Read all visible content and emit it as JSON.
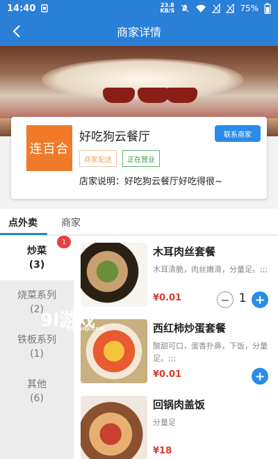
{
  "status_bar": {
    "time": "14:40",
    "speed_value": "23.8",
    "speed_unit": "KB/S",
    "battery": "75%"
  },
  "navbar": {
    "title": "商家详情",
    "back_icon": "back-arrow-icon"
  },
  "shop": {
    "logo_text": "连百合",
    "name": "好吃狗云餐厅",
    "tags": [
      "商家配送",
      "正在营业"
    ],
    "contact_label": "联系商家",
    "description": "店家说明：好吃狗云餐厅好吃得很~"
  },
  "tabs": [
    {
      "label": "点外卖",
      "active": true
    },
    {
      "label": "商家",
      "active": false
    }
  ],
  "categories": [
    {
      "name": "炒菜",
      "count": "(3)",
      "active": true
    },
    {
      "name": "烧菜系列",
      "count": "(2)",
      "active": false
    },
    {
      "name": "铁板系列",
      "count": "(1)",
      "active": false
    },
    {
      "name": "其他",
      "count": "(6)",
      "active": false
    }
  ],
  "cart_badge": "1",
  "menu_items": [
    {
      "name": "木耳肉丝套餐",
      "desc": "木耳清脆，肉丝嫩滑，分量足。;;;",
      "price": "¥0.01",
      "qty": "1"
    },
    {
      "name": "西红柿炒蛋套餐",
      "desc": "酸甜可口，蛋香扑鼻，下饭，分量足。;;;",
      "price": "¥0.01"
    },
    {
      "name": "回锅肉盖饭",
      "desc": "分量足",
      "price": "¥18"
    }
  ],
  "watermark": {
    "main": "9l游戏",
    "url": "91danji.com"
  }
}
